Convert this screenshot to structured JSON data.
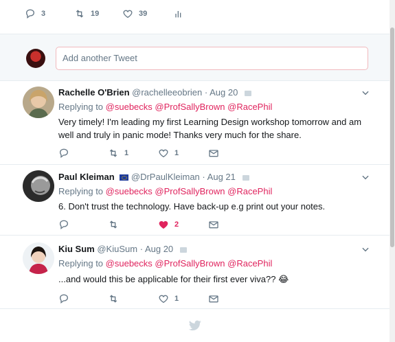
{
  "main_tweet_actions": {
    "replies": "3",
    "retweets": "19",
    "likes": "39"
  },
  "compose": {
    "placeholder": "Add another Tweet"
  },
  "replies": [
    {
      "name": "Rachelle O'Brien",
      "handle": "@rachelleeobrien",
      "sep": "·",
      "date": "Aug 20",
      "replying_prefix": "Replying to",
      "mentions": [
        "@suebecks",
        "@ProfSallyBrown",
        "@RacePhil"
      ],
      "text": "Very timely! I'm leading my first Learning Design workshop tomorrow and am well and truly in panic mode! Thanks very much for the share.",
      "retweets": "1",
      "likes": "1"
    },
    {
      "name": "Paul Kleiman",
      "handle": "@DrPaulKleiman",
      "sep": "·",
      "date": "Aug 21",
      "replying_prefix": "Replying to",
      "mentions": [
        "@suebecks",
        "@ProfSallyBrown",
        "@RacePhil"
      ],
      "text": "6. Don't trust the technology. Have back-up e.g print out your notes.",
      "retweets": "",
      "likes": "2"
    },
    {
      "name": "Kiu Sum",
      "handle": "@KiuSum",
      "sep": "·",
      "date": "Aug 20",
      "replying_prefix": "Replying to",
      "mentions": [
        "@suebecks",
        "@ProfSallyBrown",
        "@RacePhil"
      ],
      "text": "...and would this be applicable for their first ever viva?? 😂",
      "retweets": "",
      "likes": "1"
    }
  ],
  "icons": {
    "reply": "reply-icon",
    "retweet": "retweet-icon",
    "like": "heart-icon",
    "message": "envelope-icon",
    "analytics": "analytics-icon",
    "more": "chevron-down-icon",
    "logo": "twitter-bird-icon"
  },
  "colors": {
    "accent_mention": "#e0245e",
    "muted": "#657786",
    "text": "#14171a",
    "like_active": "#e0245e"
  }
}
